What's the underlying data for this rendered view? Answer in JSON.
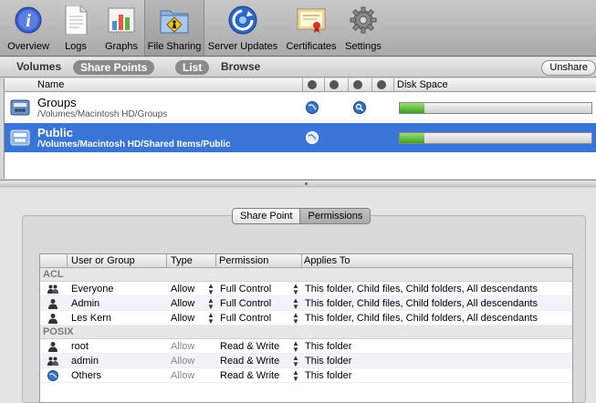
{
  "toolbar": {
    "items": [
      {
        "label": "Overview",
        "icon": "info-icon"
      },
      {
        "label": "Logs",
        "icon": "document-icon"
      },
      {
        "label": "Graphs",
        "icon": "bar-chart-icon"
      },
      {
        "label": "File Sharing",
        "icon": "shared-folder-icon",
        "active": true
      },
      {
        "label": "Server Updates",
        "icon": "software-update-icon"
      },
      {
        "label": "Certificates",
        "icon": "certificate-icon"
      },
      {
        "label": "Settings",
        "icon": "gear-icon"
      }
    ]
  },
  "segment": {
    "volumes": "Volumes",
    "share_points": "Share Points",
    "list": "List",
    "browse": "Browse",
    "unshare": "Unshare"
  },
  "share_list": {
    "columns": {
      "name": "Name",
      "disk_space": "Disk Space"
    },
    "rows": [
      {
        "name": "Groups",
        "path": "/Volumes/Macintosh HD/Groups",
        "disk_fill": 0.13,
        "selected": false
      },
      {
        "name": "Public",
        "path": "/Volumes/Macintosh HD/Shared Items/Public",
        "disk_fill": 0.13,
        "selected": true
      }
    ]
  },
  "tabs": {
    "share_point": "Share Point",
    "permissions": "Permissions"
  },
  "permissions": {
    "columns": {
      "user": "User or Group",
      "type": "Type",
      "permission": "Permission",
      "applies": "Applies To"
    },
    "acl_label": "ACL",
    "posix_label": "POSIX",
    "acl": [
      {
        "user": "Everyone",
        "icon": "group-icon",
        "type": "Allow",
        "permission": "Full Control",
        "applies": "This folder, Child files, Child folders, All descendants"
      },
      {
        "user": "Admin",
        "icon": "user-icon",
        "type": "Allow",
        "permission": "Full Control",
        "applies": "This folder, Child files, Child folders, All descendants"
      },
      {
        "user": "Les Kern",
        "icon": "user-icon",
        "type": "Allow",
        "permission": "Full Control",
        "applies": "This folder, Child files, Child folders, All descendants"
      }
    ],
    "posix": [
      {
        "user": "root",
        "icon": "user-icon",
        "type": "Allow",
        "permission": "Read & Write",
        "applies": "This folder"
      },
      {
        "user": "admin",
        "icon": "group-icon",
        "type": "Allow",
        "permission": "Read & Write",
        "applies": "This folder"
      },
      {
        "user": "Others",
        "icon": "globe-icon",
        "type": "Allow",
        "permission": "Read & Write",
        "applies": "This folder"
      }
    ]
  },
  "colors": {
    "selection": "#3875d7",
    "disk_fill": "#3f9f22"
  }
}
